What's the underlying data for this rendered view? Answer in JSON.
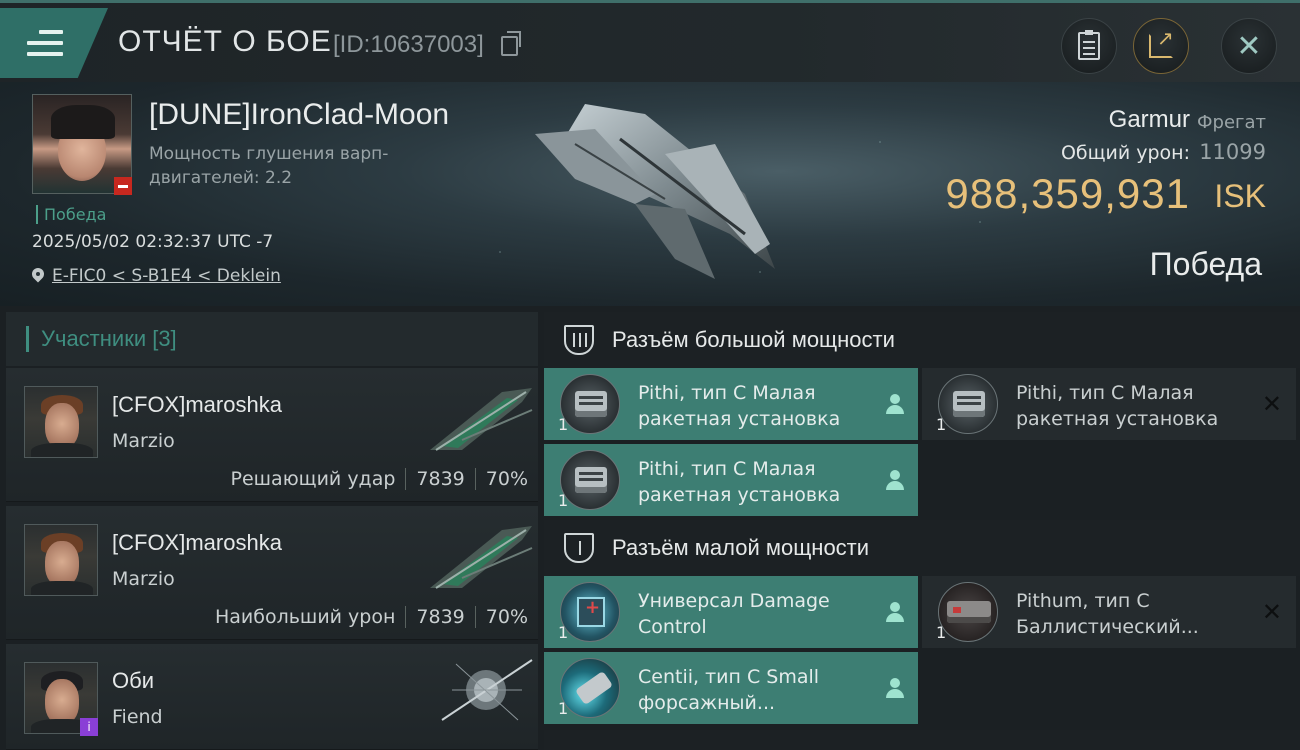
{
  "header": {
    "title": "ОТЧЁТ О БОЕ",
    "report_id": "[ID:10637003]"
  },
  "victim": {
    "name": "[DUNE]IronClad-Moon",
    "attribute": "Мощность глушения варп-двигателей: 2.2",
    "result_tag": "Победа",
    "datetime": "2025/05/02 02:32:37 UTC -7",
    "location": "E-FIC0 < S-B1E4 < Deklein",
    "ship_name": "Garmur",
    "ship_class": "Фрегат",
    "damage_label": "Общий урон:",
    "damage_value": "11099",
    "isk_value": "988,359,931",
    "isk_unit": "ISK",
    "result": "Победа"
  },
  "participants": {
    "title": "Участники [3]",
    "rows": [
      {
        "name": "[CFOX]maroshka",
        "ship": "Marzio",
        "role": "Решающий удар",
        "damage": "7839",
        "percent": "70%"
      },
      {
        "name": "[CFOX]maroshka",
        "ship": "Marzio",
        "role": "Наибольший урон",
        "damage": "7839",
        "percent": "70%"
      },
      {
        "name": "Оби",
        "ship": "Fiend",
        "badge": "i"
      }
    ]
  },
  "slots": {
    "high": {
      "title": "Разъём большой мощности",
      "modules": [
        {
          "name": "Pithi, тип C Малая ракетная установка",
          "qty": "1",
          "icon": "missile-launcher-icon",
          "fitted": true
        },
        {
          "name": "Pithi, тип C Малая ракетная установка",
          "qty": "1",
          "icon": "missile-launcher-icon",
          "fitted": false
        },
        {
          "name": "Pithi, тип C Малая ракетная установка",
          "qty": "1",
          "icon": "missile-launcher-icon",
          "fitted": true
        }
      ]
    },
    "low": {
      "title": "Разъём малой мощности",
      "modules": [
        {
          "name": "Универсал Damage Control",
          "qty": "1",
          "icon": "damage-control-icon",
          "fitted": true
        },
        {
          "name": "Pithum, тип C Баллистический...",
          "qty": "1",
          "icon": "ballistic-control-icon",
          "fitted": false
        },
        {
          "name": "Centii, тип C Small форсажный...",
          "qty": "1",
          "icon": "afterburner-icon",
          "fitted": true
        }
      ]
    }
  },
  "colors": {
    "accent": "#3d7e73",
    "isk": "#e7c07a",
    "victory": "#4c9f8a"
  }
}
